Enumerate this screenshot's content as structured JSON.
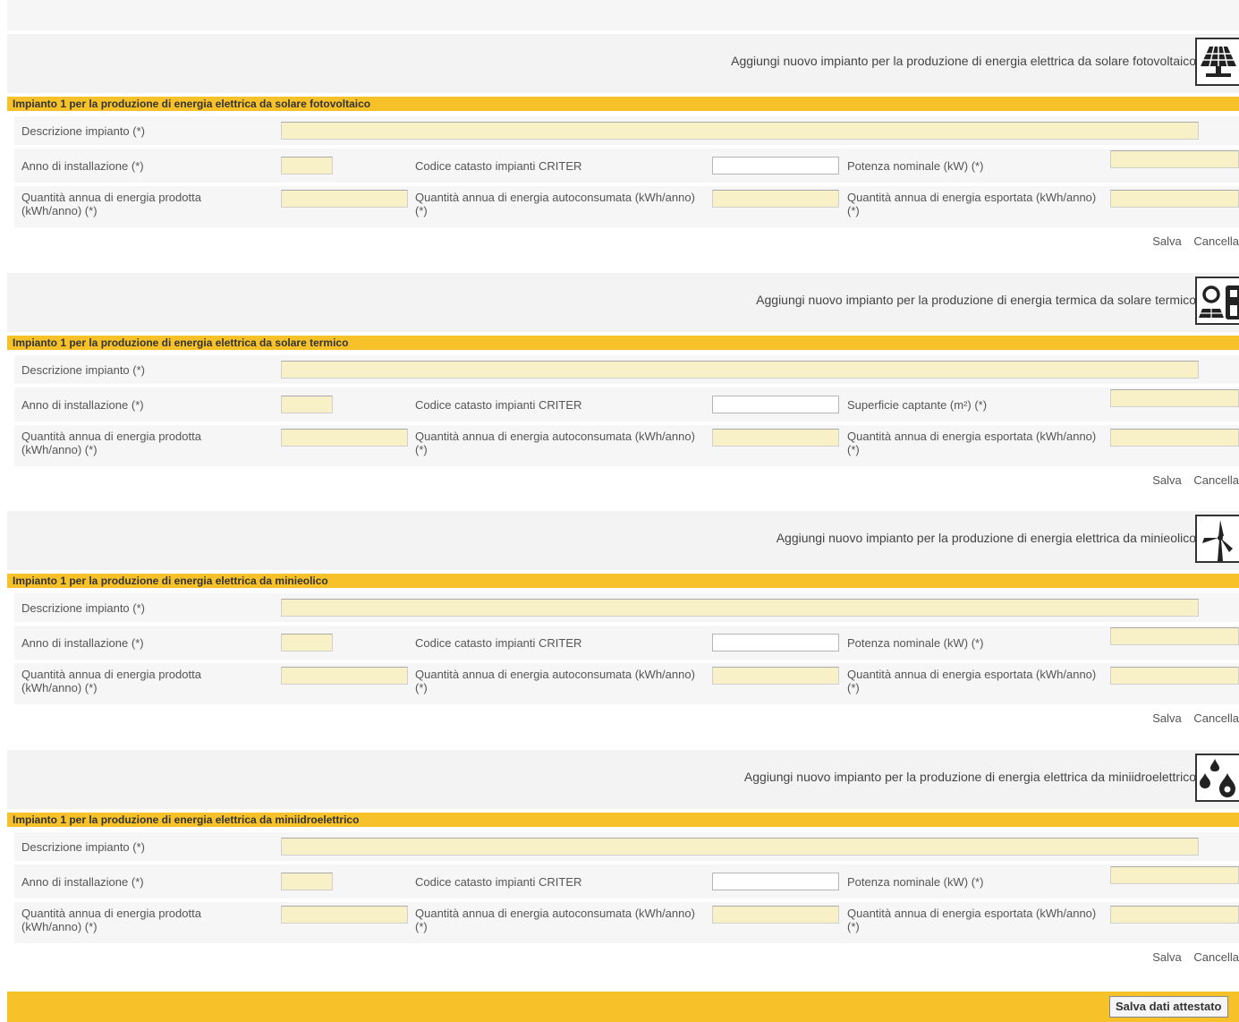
{
  "sections": [
    {
      "add_link": "Aggiungi nuovo impianto per la produzione di energia elettrica da solare fotovoltaico",
      "icon": "solar-panel-icon",
      "header": "Impianto 1 per la produzione di energia elettrica da solare fotovoltaico",
      "descrizione_label": "Descrizione impianto (*)",
      "anno_label": "Anno di installazione (*)",
      "codice_label": "Codice catasto impianti CRITER",
      "third_label": "Potenza nominale (kW) (*)",
      "prodotta_label": "Quantità annua di energia prodotta (kWh/anno) (*)",
      "autoconsumata_label": "Quantità annua di energia autoconsumata (kWh/anno) (*)",
      "esportata_label": "Quantità annua di energia esportata (kWh/anno) (*)",
      "save_label": "Salva",
      "cancel_label": "Cancella"
    },
    {
      "add_link": "Aggiungi nuovo impianto per la produzione di energia termica da solare termico",
      "icon": "solar-thermal-icon",
      "header": "Impianto 1 per la produzione di energia elettrica da solare termico",
      "descrizione_label": "Descrizione impianto (*)",
      "anno_label": "Anno di installazione (*)",
      "codice_label": "Codice catasto impianti CRITER",
      "third_label": "Superficie captante (m²) (*)",
      "prodotta_label": "Quantità annua di energia prodotta (kWh/anno) (*)",
      "autoconsumata_label": "Quantità annua di energia autoconsumata (kWh/anno) (*)",
      "esportata_label": "Quantità annua di energia esportata (kWh/anno) (*)",
      "save_label": "Salva",
      "cancel_label": "Cancella"
    },
    {
      "add_link": "Aggiungi nuovo impianto per la produzione di energia elettrica da minieolico",
      "icon": "wind-turbine-icon",
      "header": "Impianto 1 per la produzione di energia elettrica da minieolico",
      "descrizione_label": "Descrizione impianto (*)",
      "anno_label": "Anno di installazione (*)",
      "codice_label": "Codice catasto impianti CRITER",
      "third_label": "Potenza nominale (kW) (*)",
      "prodotta_label": "Quantità annua di energia prodotta (kWh/anno) (*)",
      "autoconsumata_label": "Quantità annua di energia autoconsumata (kWh/anno) (*)",
      "esportata_label": "Quantità annua di energia esportata (kWh/anno) (*)",
      "save_label": "Salva",
      "cancel_label": "Cancella"
    },
    {
      "add_link": "Aggiungi nuovo impianto per la produzione di energia elettrica da miniidroelettrico",
      "icon": "water-drops-icon",
      "header": "Impianto 1 per la produzione di energia elettrica da miniidroelettrico",
      "descrizione_label": "Descrizione impianto (*)",
      "anno_label": "Anno di installazione (*)",
      "codice_label": "Codice catasto impianti CRITER",
      "third_label": "Potenza nominale (kW) (*)",
      "prodotta_label": "Quantità annua di energia prodotta (kWh/anno) (*)",
      "autoconsumata_label": "Quantità annua di energia autoconsumata (kWh/anno) (*)",
      "esportata_label": "Quantità annua di energia esportata (kWh/anno) (*)",
      "save_label": "Salva",
      "cancel_label": "Cancella"
    }
  ],
  "footer": {
    "save_button": "Salva dati attestato"
  },
  "colors": {
    "header_bar": "#f7c229",
    "input_fill": "#f8f0c6",
    "row_bg": "#f6f6f6"
  }
}
